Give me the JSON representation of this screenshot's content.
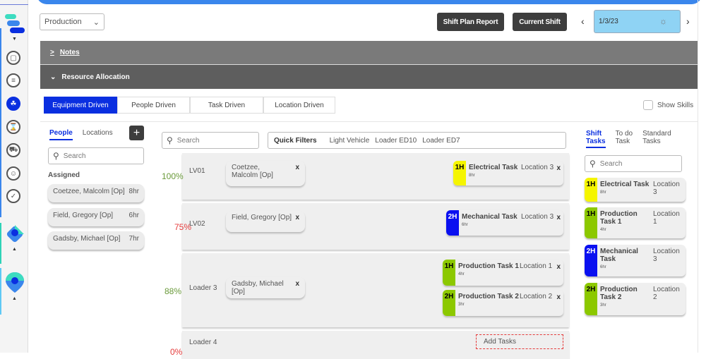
{
  "header": {
    "plant_select": "Production",
    "shift_plan_report": "Shift Plan Report",
    "current_shift": "Current Shift",
    "date": "1/3/23",
    "prev_icon": "‹",
    "next_icon": "›"
  },
  "accordions": {
    "notes": "Notes",
    "resource_allocation": "Resource Allocation"
  },
  "view_tabs": [
    {
      "label": "Equipment Driven",
      "active": true
    },
    {
      "label": "People Driven",
      "active": false
    },
    {
      "label": "Task Driven",
      "active": false
    },
    {
      "label": "Location Driven",
      "active": false
    }
  ],
  "show_skills": "Show Skills",
  "left_panel": {
    "tabs": [
      "People",
      "Locations"
    ],
    "add_icon": "+",
    "search_placeholder": "Search",
    "assigned_label": "Assigned",
    "people": [
      {
        "name": "Coetzee, Malcolm [Op]",
        "hours": "8hr"
      },
      {
        "name": "Field, Gregory [Op]",
        "hours": "6hr"
      },
      {
        "name": "Gadsby, Michael [Op]",
        "hours": "7hr"
      }
    ]
  },
  "center": {
    "search_placeholder": "Search",
    "quick_filters_label": "Quick Filters",
    "quick_filters": [
      "Light Vehicle",
      "Loader ED10",
      "Loader ED7"
    ],
    "rows": [
      {
        "pct": "100%",
        "pct_color": "#6a9a3a",
        "equipment": "LV01",
        "person": "Coetzee, Malcolm [Op]",
        "tasks": [
          {
            "priority": "1H",
            "color": "#f5f500",
            "text_color": "#000",
            "name": "Electrical Task",
            "location": "Location 3",
            "hours": "8hr"
          }
        ]
      },
      {
        "pct": "75%",
        "pct_color": "#e53b3b",
        "equipment": "LV02",
        "person": "Field, Gregory [Op]",
        "tasks": [
          {
            "priority": "2H",
            "color": "#0a10f0",
            "text_color": "#fff",
            "name": "Mechanical Task",
            "location": "Location 3",
            "hours": "6hr"
          }
        ]
      },
      {
        "pct": "88%",
        "pct_color": "#6a9a3a",
        "equipment": "Loader 3",
        "person": "Gadsby, Michael [Op]",
        "tasks": [
          {
            "priority": "1H",
            "color": "#8cc800",
            "text_color": "#000",
            "name": "Production Task 1",
            "location": "Location 1",
            "hours": "4hr"
          },
          {
            "priority": "2H",
            "color": "#8cc800",
            "text_color": "#000",
            "name": "Production Task 2",
            "location": "Location 2",
            "hours": "3hr"
          }
        ]
      },
      {
        "pct": "0%",
        "pct_color": "#e53b3b",
        "equipment": "Loader 4",
        "add_tasks": "Add Tasks"
      }
    ],
    "remove_icon": "x"
  },
  "right_panel": {
    "tabs": [
      {
        "line1": "Shift",
        "line2": "Tasks",
        "active": true
      },
      {
        "line1": "To do",
        "line2": "Task",
        "active": false
      },
      {
        "line1": "Standard",
        "line2": "Tasks",
        "active": false
      }
    ],
    "search_placeholder": "Search",
    "tasks": [
      {
        "priority": "1H",
        "color": "#f5f500",
        "text_color": "#000",
        "name": "Electrical Task",
        "location": "Location 3",
        "hours": "8hr"
      },
      {
        "priority": "1H",
        "color": "#8cc800",
        "text_color": "#000",
        "name": "Production Task 1",
        "location": "Location 1",
        "hours": "4hr"
      },
      {
        "priority": "2H",
        "color": "#0a10f0",
        "text_color": "#fff",
        "name": "Mechanical Task",
        "location": "Location 3",
        "hours": "6hr"
      },
      {
        "priority": "2H",
        "color": "#8cc800",
        "text_color": "#000",
        "name": "Production Task 2",
        "location": "Location 2",
        "hours": "3hr"
      }
    ]
  },
  "rail": {
    "icons": [
      "app-logo-icon",
      "square-icon",
      "chart-icon",
      "network-icon",
      "hourglass-icon",
      "truck-icon",
      "person-icon",
      "check-icon",
      "location-diamond-icon",
      "map-pin-icon"
    ]
  }
}
